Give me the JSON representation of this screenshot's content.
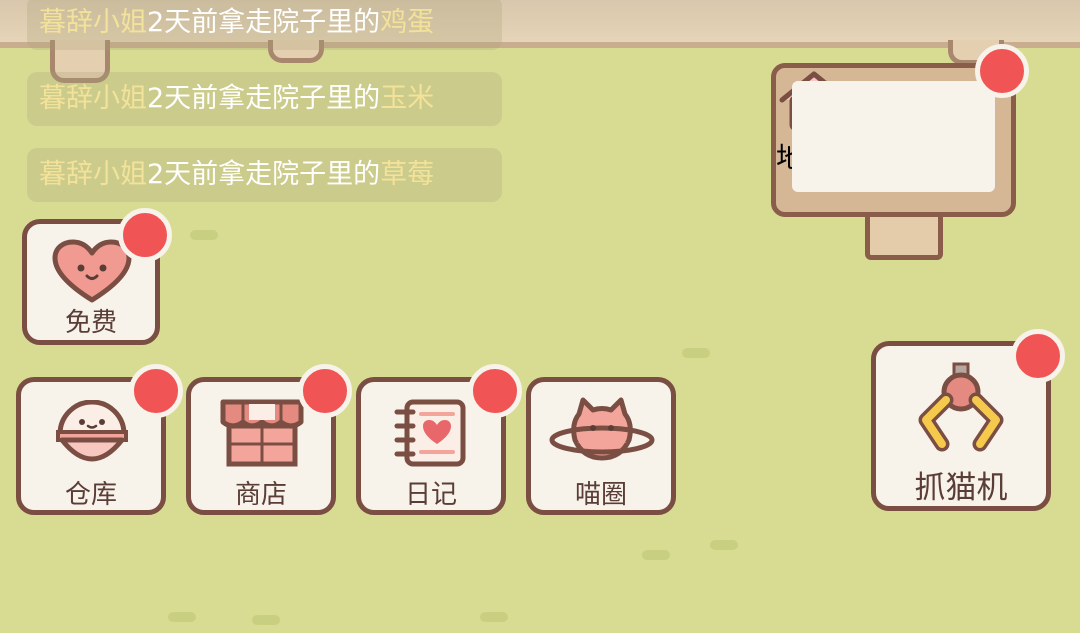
{
  "notifications": [
    {
      "name": "暮辞小姐",
      "text": "2天前拿走院子里的",
      "item": "鸡蛋"
    },
    {
      "name": "暮辞小姐",
      "text": "2天前拿走院子里的",
      "item": "玉米"
    },
    {
      "name": "暮辞小姐",
      "text": "2天前拿走院子里的",
      "item": "草莓"
    }
  ],
  "buttons": {
    "map": {
      "label": "地图",
      "icon": "house-icon",
      "has_badge": true
    },
    "free": {
      "label": "免费",
      "icon": "heart-face-icon",
      "has_badge": true
    },
    "storage": {
      "label": "仓库",
      "icon": "bowl-face-icon",
      "has_badge": true
    },
    "shop": {
      "label": "商店",
      "icon": "shop-stall-icon",
      "has_badge": true
    },
    "diary": {
      "label": "日记",
      "icon": "notebook-heart-icon",
      "has_badge": true
    },
    "cat_circle": {
      "label": "喵圈",
      "icon": "cat-planet-icon",
      "has_badge": false
    },
    "claw_machine": {
      "label": "抓猫机",
      "icon": "claw-icon",
      "has_badge": true
    }
  },
  "colors": {
    "background": "#d8dc93",
    "badge": "#f05454",
    "button_border": "#7a4e42",
    "button_fill": "#f7f2ea",
    "highlight_text": "#f3e29a"
  }
}
